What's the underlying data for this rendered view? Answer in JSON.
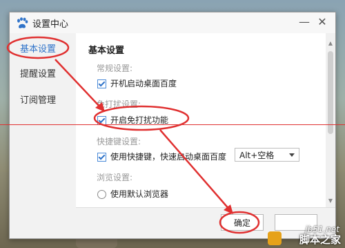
{
  "window": {
    "title": "设置中心",
    "minimize_glyph": "—",
    "close_glyph": "✕"
  },
  "sidebar": {
    "items": [
      {
        "label": "基本设置",
        "active": true
      },
      {
        "label": "提醒设置",
        "active": false
      },
      {
        "label": "订阅管理",
        "active": false
      }
    ]
  },
  "content": {
    "section_title": "基本设置",
    "general": {
      "label": "常规设置:",
      "startup_option": {
        "label": "开机启动桌面百度",
        "checked": true
      }
    },
    "dnd": {
      "label": "免打扰设置:",
      "enable_option": {
        "label": "开启免打扰功能",
        "checked": true
      }
    },
    "hotkey": {
      "label": "快捷键设置:",
      "use_option": {
        "label": "使用快捷键，快速启动桌面百度",
        "checked": true
      },
      "select_value": "Alt+空格"
    },
    "browser": {
      "label": "浏览设置:",
      "default_option": {
        "label": "使用默认浏览器",
        "checked": false
      }
    }
  },
  "footer": {
    "ok_label": "确定",
    "cancel_label": ""
  },
  "watermark": {
    "site": "jb51.net",
    "name": "脚本之家"
  },
  "colors": {
    "accent": "#2f73c9",
    "annotation": "#e03030"
  }
}
